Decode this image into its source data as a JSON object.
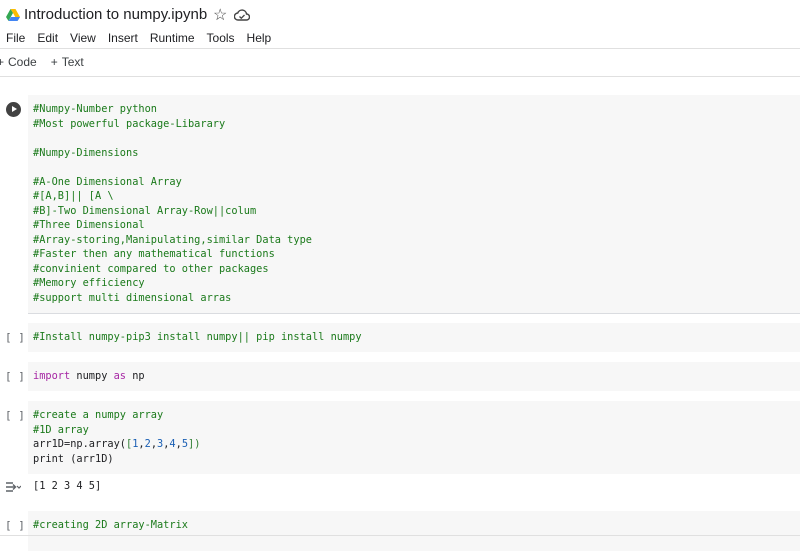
{
  "header": {
    "title": "Introduction to numpy.ipynb",
    "star_icon": "star-outline-icon",
    "cloud_icon": "cloud-saved-icon"
  },
  "menu": [
    "File",
    "Edit",
    "View",
    "Insert",
    "Runtime",
    "Tools",
    "Help"
  ],
  "toolbar": {
    "code_label": "Code",
    "text_label": "Text"
  },
  "cells": {
    "c1": {
      "run_icon": "play-circle-icon",
      "lines": [
        "#Numpy-Number python",
        "#Most powerful package-Libarary",
        "",
        "#Numpy-Dimensions",
        "",
        "#A-One Dimensional Array",
        "#[A,B]|| [A \\",
        "#B]-Two Dimensional Array-Row||colum",
        "#Three Dimensional",
        "#Array-storing,Manipulating,similar Data type",
        "#Faster then any mathematical functions",
        "#convinient compared to other packages",
        "#Memory efficiency",
        "#support multi dimensional arras"
      ]
    },
    "c2": {
      "bracket": "[ ]",
      "line": "#Install numpy-pip3 install numpy|| pip install numpy"
    },
    "c3": {
      "bracket": "[ ]",
      "kw_import": "import",
      "mod": " numpy ",
      "kw_as": "as",
      "alias": " np"
    },
    "c4": {
      "bracket": "[ ]",
      "comment1": "#create a numpy array",
      "comment2": "#1D array",
      "assign": "arr1D=np.array(",
      "open": "[",
      "n1": "1",
      "n2": "2",
      "n3": "3",
      "n4": "4",
      "n5": "5",
      "comma": ",",
      "close": "])",
      "print_line": "print (arr1D)",
      "output_icon": "output-toggle-icon",
      "output": "[1 2 3 4 5]"
    },
    "c5": {
      "bracket": "[ ]",
      "line": "#creating 2D array-Matrix"
    }
  }
}
